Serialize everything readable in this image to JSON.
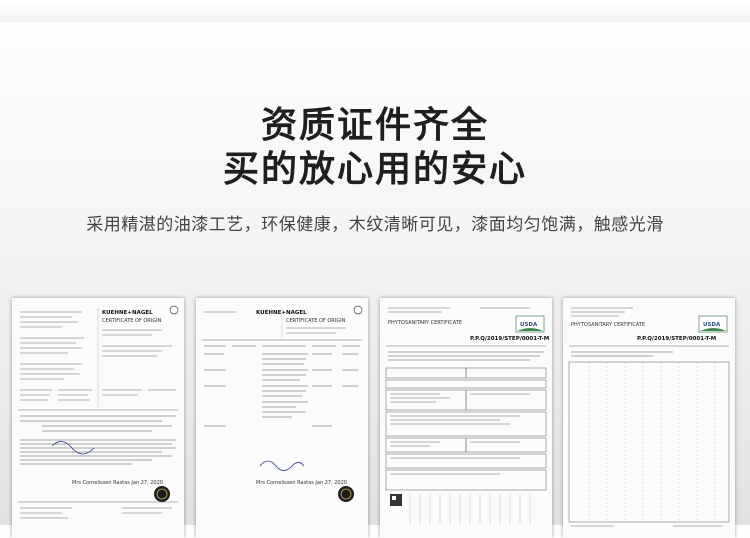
{
  "headline": {
    "line1": "资质证件齐全",
    "line2": "买的放心用的安心"
  },
  "subtitle": "采用精湛的油漆工艺，环保健康，木纹清晰可见，漆面均匀饱满，触感光滑",
  "documents": [
    {
      "brand": "KUEHNE+NAGEL",
      "title": "CERTIFICATE OF ORIGIN",
      "signature": "Mrs Cornelissen Rastas Jan 27, 2020"
    },
    {
      "brand": "KUEHNE+NAGEL",
      "title": "CERTIFICATE OF ORIGIN",
      "signature": "Mrs Cornelissen Rastas Jan 27, 2020"
    },
    {
      "brand": "USDA",
      "title": "PHYTOSANITARY CERTIFICATE",
      "number": "P.P.Q/2019/STEP/0001-T-M"
    },
    {
      "brand": "USDA",
      "title": "PHYTOSANITARY CERTIFICATE",
      "number": "P.P.Q/2019/STEP/0001-T-M"
    }
  ]
}
